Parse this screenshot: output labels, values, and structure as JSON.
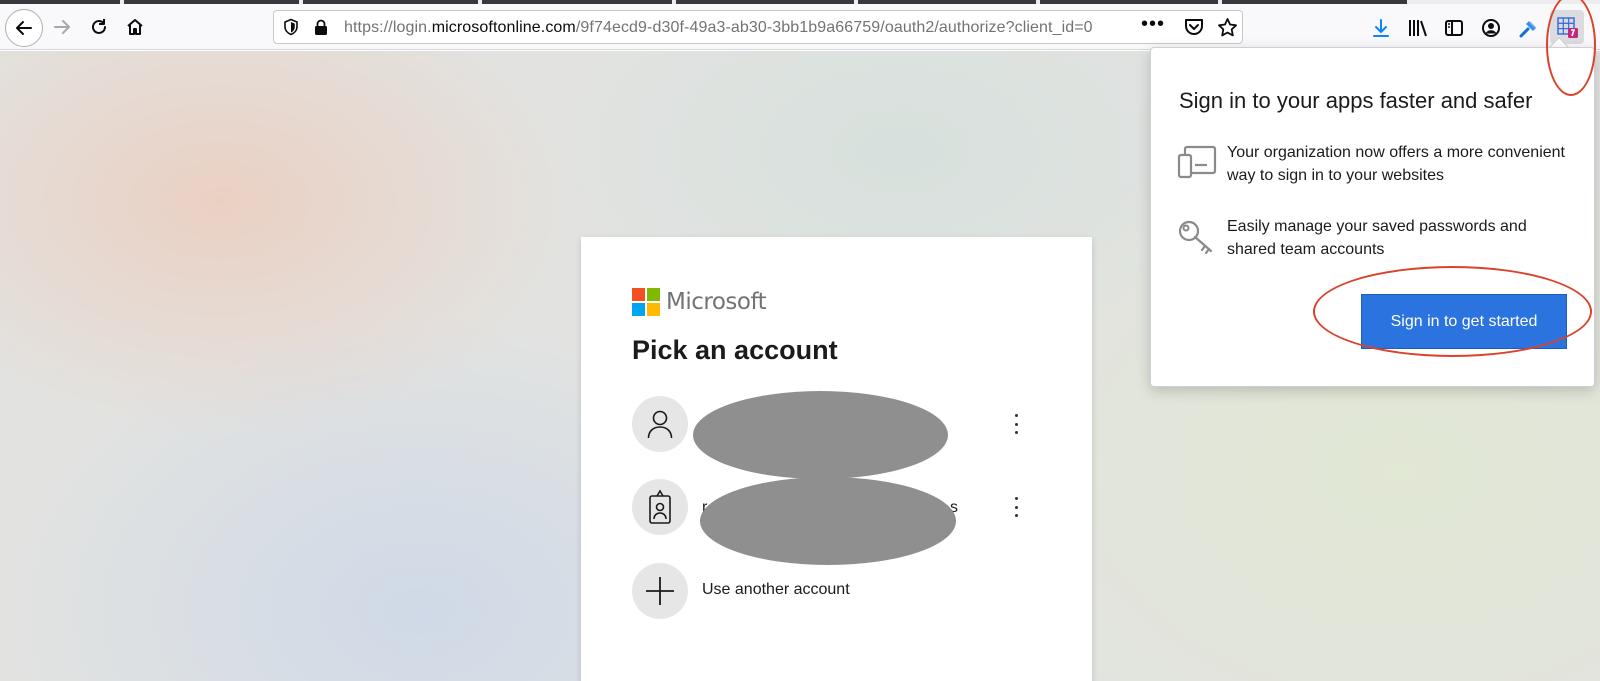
{
  "browser": {
    "url_prefix": "https://login.",
    "url_host": "microsoftonline.com",
    "url_path": "/9f74ecd9-d30f-49a3-ab30-3bb1b9a66759/oauth2/authorize?client_id=0",
    "url_more": "•••",
    "toolbar_icons": [
      "back-icon",
      "forward-icon",
      "reload-icon",
      "home-icon",
      "shield-icon",
      "lock-icon",
      "pocket-icon",
      "star-icon",
      "download-icon",
      "library-icon",
      "sidebar-icon",
      "account-icon",
      "extension-key-icon",
      "apps-extension-icon"
    ]
  },
  "login_card": {
    "brand": "Microsoft",
    "title": "Pick an account",
    "accounts": [
      {
        "label": "",
        "icon": "person-icon"
      },
      {
        "label_start": "r",
        "label_end": "s",
        "icon": "badge-icon"
      }
    ],
    "add_account_label": "Use another account"
  },
  "popup": {
    "title": "Sign in to your apps faster and safer",
    "features": [
      {
        "icon": "devices-icon",
        "text": "Your organization now offers a more convenient way to sign in to your websites"
      },
      {
        "icon": "key-icon",
        "text": "Easily manage your saved passwords and shared team accounts"
      }
    ],
    "button_label": "Sign in to get started"
  },
  "colors": {
    "primary_button": "#2b73de",
    "annotation": "#d9432b",
    "ms_red": "#f25022",
    "ms_green": "#7fba00",
    "ms_blue": "#00a4ef",
    "ms_yellow": "#ffb900"
  }
}
